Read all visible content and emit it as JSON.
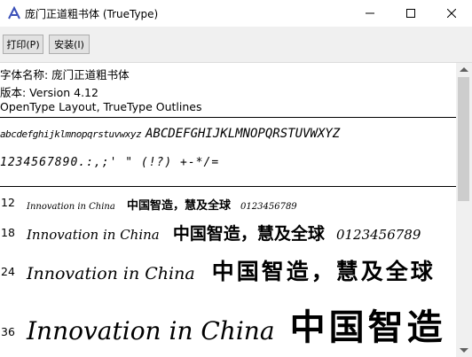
{
  "window": {
    "title": "庞门正道粗书体 (TrueType)"
  },
  "toolbar": {
    "print_label": "打印(P)",
    "install_label": "安装(I)"
  },
  "info": {
    "font_name": "字体名称: 庞门正道粗书体",
    "version": "版本: Version 4.12",
    "outline_type": "OpenType Layout, TrueType Outlines"
  },
  "glyph_sample": {
    "lowercase": "abcdefghijklmnopqrstuvwxyz",
    "uppercase": "ABCDEFGHIJKLMNOPQRSTUVWXYZ",
    "digits_symbols": "1234567890.:,;' \" (!?) +-*/="
  },
  "samples": [
    {
      "size": "12",
      "latin": "Innovation in China",
      "cjk": "中国智造，慧及全球",
      "digits": "0123456789"
    },
    {
      "size": "18",
      "latin": "Innovation in China",
      "cjk": "中国智造，慧及全球",
      "digits": "0123456789"
    },
    {
      "size": "24",
      "latin": "Innovation in China",
      "cjk": "中国智造，慧及全球",
      "digits": ""
    },
    {
      "size": "36",
      "latin": "Innovation in China",
      "cjk": "中国智造",
      "digits": ""
    }
  ],
  "icons": {
    "app": "font-viewer-icon",
    "minimize": "minimize-icon",
    "maximize": "maximize-icon",
    "close": "close-icon"
  }
}
